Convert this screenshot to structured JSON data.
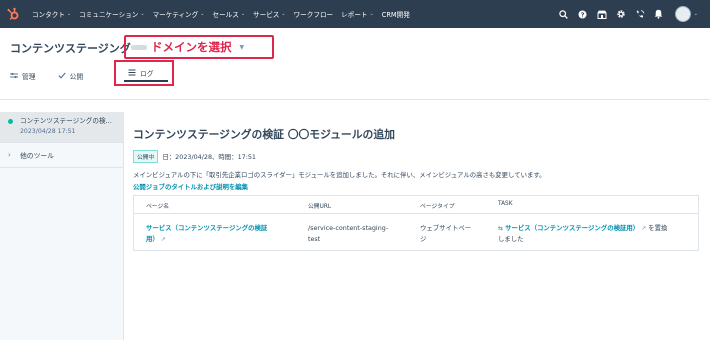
{
  "nav": {
    "logo_icon": "hubspot-sprocket-icon",
    "items": [
      {
        "label": "コンタクト",
        "has_menu": true
      },
      {
        "label": "コミュニケーション",
        "has_menu": true
      },
      {
        "label": "マーケティング",
        "has_menu": true
      },
      {
        "label": "セールス",
        "has_menu": true
      },
      {
        "label": "サービス",
        "has_menu": true
      },
      {
        "label": "ワークフロー",
        "has_menu": false
      },
      {
        "label": "レポート",
        "has_menu": true
      },
      {
        "label": "CRM開発",
        "has_menu": false
      }
    ],
    "chevron": "⌄",
    "icons": [
      "search-icon",
      "calling-icon",
      "marketplace-icon",
      "settings-icon",
      "phone-icon",
      "notifications-icon"
    ]
  },
  "header": {
    "page_title": "コンテンツステージング",
    "domain_annotation": "ドメインを選択",
    "domain_caret": "▼"
  },
  "tabs": {
    "manage": "管理",
    "public": "公開",
    "log": "ログ"
  },
  "sidebar": {
    "active_title": "コンテンツステージングの検...",
    "active_date": "2023/04/28 17:51",
    "other_tools": "他のツール"
  },
  "main": {
    "title": "コンテンツステージングの検証 〇〇モジュールの追加",
    "status_badge": "公開中",
    "datetime": "日：2023/04/28、時間：17:51",
    "description": "メインビジュアルの下に「取引先企業ロゴのスライダー」モジュールを追加しました。それに伴い、メインビジュアルの高さも変更しています。",
    "edit_link": "公開ジョブのタイトルおよび説明を編集"
  },
  "table": {
    "headers": [
      "ページ名",
      "公開URL",
      "ページタイプ",
      "TASK"
    ],
    "row": {
      "page_name_line1": "サービス（コンテンツステージングの検証",
      "page_name_line2": "用）",
      "url_line1": "/service-content-staging-",
      "url_line2": "test",
      "page_type_line1": "ウェブサイトペー",
      "page_type_line2": "ジ",
      "task_link": "サービス（コンテンツステージングの検証用）",
      "task_text_line1_suffix": "を置換",
      "task_text_line2": "しました"
    }
  },
  "colors": {
    "nav_bg": "#2d3e50",
    "annotation": "#e0264a",
    "link": "#0091ae",
    "status_green": "#00bda5"
  }
}
